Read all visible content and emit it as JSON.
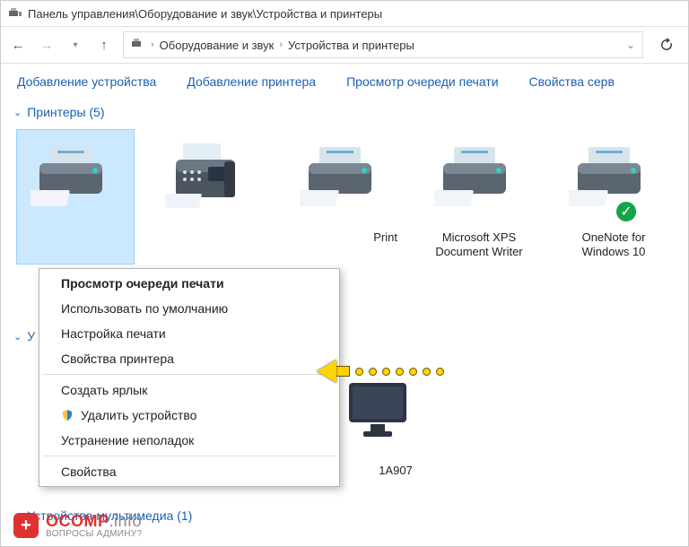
{
  "title": "Панель управления\\Оборудование и звук\\Устройства и принтеры",
  "breadcrumb": {
    "seg1": "Оборудование и звук",
    "seg2": "Устройства и принтеры"
  },
  "toolbar": {
    "add_device": "Добавление устройства",
    "add_printer": "Добавление принтера",
    "view_queue": "Просмотр очереди печати",
    "server_props": "Свойства серв"
  },
  "groups": {
    "printers": "Принтеры (5)",
    "multimedia": "Устройства мультимедиа (1)",
    "other_initial": "У"
  },
  "devices": {
    "d1_suffix": "Print",
    "d2": "Microsoft XPS Document Writer",
    "d3": "OneNote for Windows 10"
  },
  "context_menu": {
    "view_queue": "Просмотр очереди печати",
    "set_default": "Использовать по умолчанию",
    "print_prefs": "Настройка печати",
    "printer_props": "Свойства принтера",
    "create_shortcut": "Создать ярлык",
    "remove_device": "Удалить устройство",
    "troubleshoot": "Устранение неполадок",
    "properties": "Свойства"
  },
  "behind_partial": "1A907",
  "watermark": {
    "brand": "OCOMP",
    "suffix": ".info",
    "sub": "ВОПРОСЫ АДМИНУ?"
  }
}
